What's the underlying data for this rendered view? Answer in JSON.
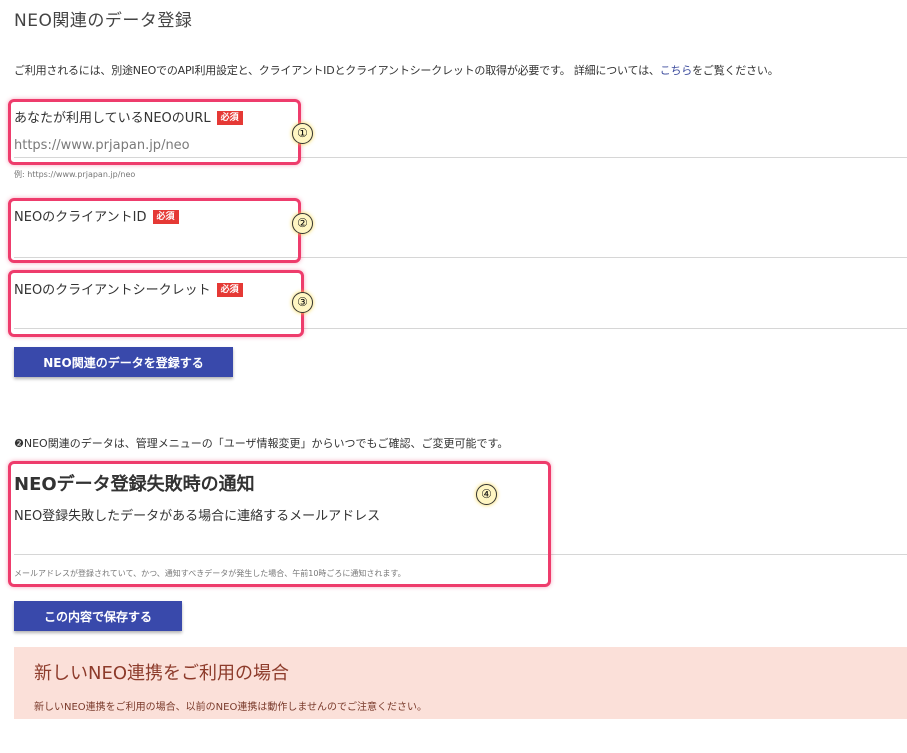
{
  "page": {
    "title": "NEO関連のデータ登録",
    "intro_before": "ご利用されるには、別途NEOでのAPI利用設定と、クライアントIDとクライアントシークレットの取得が必要です。 詳細については、",
    "intro_link": "こちら",
    "intro_after": "をご覧ください。"
  },
  "form": {
    "required_badge": "必須",
    "url": {
      "label": "あなたが利用しているNEOのURL",
      "placeholder": "https://www.prjapan.jp/neo",
      "hint": "例: https://www.prjapan.jp/neo"
    },
    "client_id": {
      "label": "NEOのクライアントID",
      "value": ""
    },
    "client_secret": {
      "label": "NEOのクライアントシークレット",
      "value": ""
    },
    "submit_label": "NEO関連のデータを登録する"
  },
  "note": "❷NEO関連のデータは、管理メニューの「ユーザ情報変更」からいつでもご確認、ご変更可能です。",
  "notification": {
    "title": "NEOデータ登録失敗時の通知",
    "email_label": "NEO登録失敗したデータがある場合に連絡するメールアドレス",
    "email_value": "",
    "hint": "メールアドレスが登録されていて、かつ、通知すべきデータが発生した場合、午前10時ごろに通知されます。",
    "save_label": "この内容で保存する"
  },
  "annotations": [
    "①",
    "②",
    "③",
    "④"
  ],
  "notice": {
    "title": "新しいNEO連携をご利用の場合",
    "text": "新しいNEO連携をご利用の場合、以前のNEO連携は動作しませんのでご注意ください。"
  },
  "colors": {
    "primary_button": "#3949ab",
    "required_badge": "#e53935",
    "highlight_border": "#ee3c6c",
    "link": "#3b4a9c",
    "notice_bg": "#fbe0d9",
    "notice_text": "#8d3b2b"
  }
}
